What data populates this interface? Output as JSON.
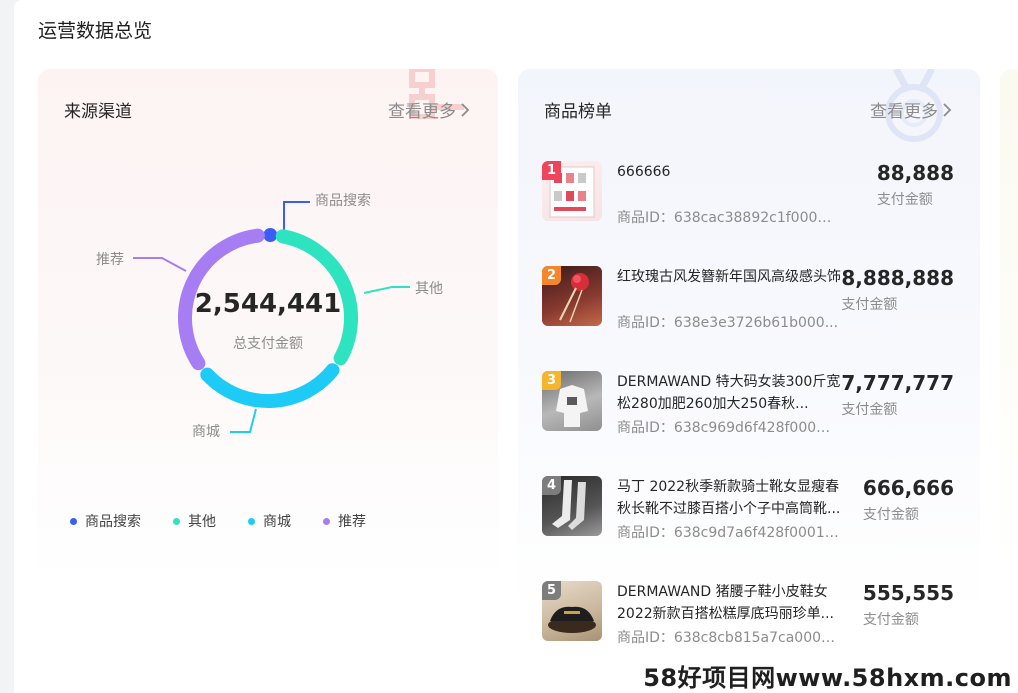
{
  "page": {
    "title": "运营数据总览"
  },
  "source_card": {
    "title": "来源渠道",
    "more_label": "查看更多",
    "total": "2,544,441",
    "total_label": "总支付金额",
    "channels": [
      {
        "name": "商品搜索",
        "value": 2,
        "color": "#3b5cf5"
      },
      {
        "name": "其他",
        "value": 33,
        "color": "#2ee3bf"
      },
      {
        "name": "商城",
        "value": 30,
        "color": "#1ecbf7"
      },
      {
        "name": "推荐",
        "value": 35,
        "color": "#a77df3"
      }
    ],
    "chart_data": {
      "type": "pie",
      "categories": [
        "商品搜索",
        "其他",
        "商城",
        "推荐"
      ],
      "values": [
        2,
        33,
        30,
        35
      ]
    }
  },
  "rank_card": {
    "title": "商品榜单",
    "more_label": "查看更多",
    "items": [
      {
        "rank": "1",
        "name": "666666",
        "id": "商品ID：638cac38892c1f0001...",
        "amount": "88,888",
        "amount_label": "支付金额",
        "badge_color": "#f0445a"
      },
      {
        "rank": "2",
        "name": "红玫瑰古风发簪新年国风高级感头饰",
        "id": "商品ID：638e3e3726b61b000...",
        "amount": "8,888,888",
        "amount_label": "支付金额",
        "badge_color": "#f5862c"
      },
      {
        "rank": "3",
        "name": "DERMAWAND 特大码女装300斤宽松280加肥260加大250春秋...",
        "id": "商品ID：638c969d6f428f00017...",
        "amount": "7,777,777",
        "amount_label": "支付金额",
        "badge_color": "#f5b52c"
      },
      {
        "rank": "4",
        "name": "马丁 2022秋季新款骑士靴女显瘦春秋长靴不过膝百搭小个子中高筒靴...",
        "id": "商品ID：638c9d7a6f428f00017...",
        "amount": "666,666",
        "amount_label": "支付金额",
        "badge_color": "#7d7d7d"
      },
      {
        "rank": "5",
        "name": "DERMAWAND 猪腰子鞋小皮鞋女2022新款百搭松糕厚底玛丽珍单...",
        "id": "商品ID：638c8cb815a7ca0001...",
        "amount": "555,555",
        "amount_label": "支付金额",
        "badge_color": "#7d7d7d"
      }
    ]
  },
  "watermark": "58好项目网www.58hxm.com"
}
